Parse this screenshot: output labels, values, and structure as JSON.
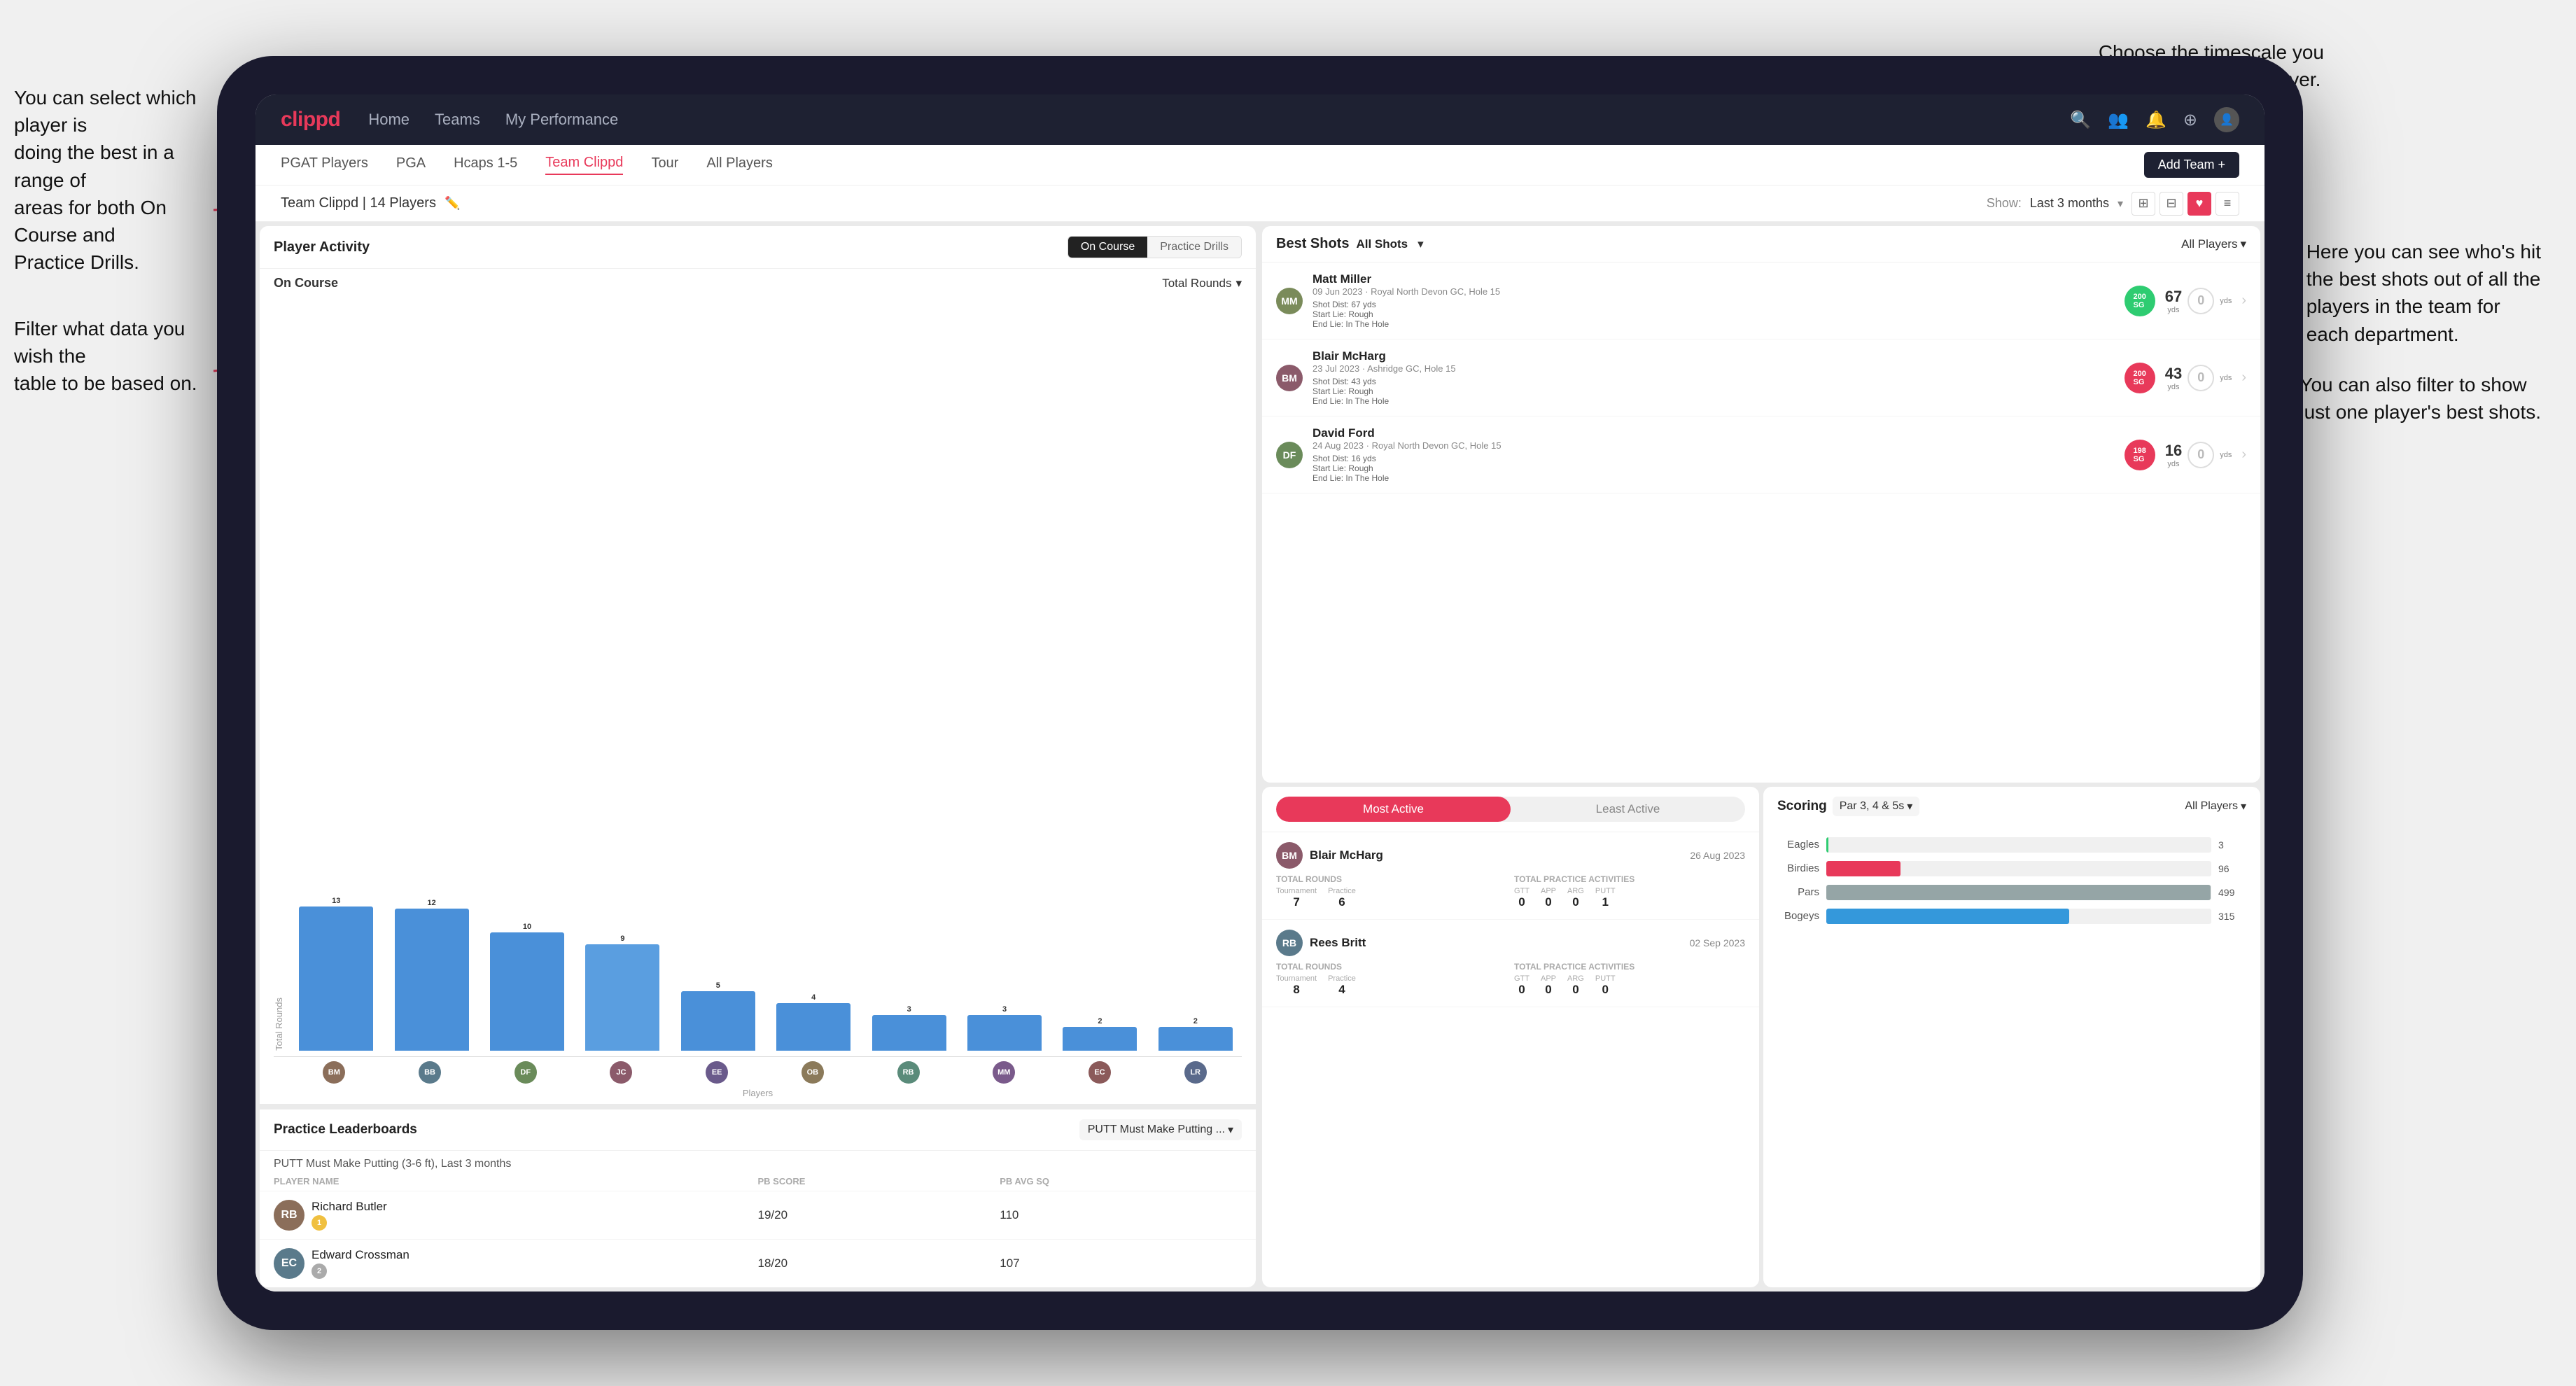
{
  "annotations": {
    "top_right": "Choose the timescale you\nwish to see the data over.",
    "left_1": "You can select which player is\ndoing the best in a range of\nareas for both On Course and\nPractice Drills.",
    "left_2": "Filter what data you wish the\ntable to be based on.",
    "right_1": "Here you can see who's hit\nthe best shots out of all the\nplayers in the team for\neach department.",
    "right_2": "You can also filter to show\njust one player's best shots."
  },
  "nav": {
    "logo": "clippd",
    "items": [
      "Home",
      "Teams",
      "My Performance"
    ],
    "icons": [
      "🔍",
      "👥",
      "🔔",
      "⊕",
      "👤"
    ],
    "add_team_label": "Add Team +"
  },
  "tabs": {
    "items": [
      "PGAT Players",
      "PGA",
      "Hcaps 1-5",
      "Team Clippd",
      "Tour",
      "All Players"
    ],
    "active": "Team Clippd"
  },
  "sub_header": {
    "title": "Team Clippd | 14 Players",
    "show_label": "Show:",
    "show_value": "Last 3 months",
    "view_icons": [
      "grid",
      "grid2",
      "heart",
      "list"
    ]
  },
  "player_activity": {
    "title": "Player Activity",
    "toggle": [
      "On Course",
      "Practice Drills"
    ],
    "active_toggle": "On Course",
    "sub_title": "On Course",
    "filter": "Total Rounds",
    "y_label": "Total Rounds",
    "x_label": "Players",
    "bars": [
      {
        "label": "B. McHarg",
        "value": 13,
        "height": 100
      },
      {
        "label": "B. Britt",
        "value": 12,
        "height": 92
      },
      {
        "label": "D. Ford",
        "value": 10,
        "height": 77
      },
      {
        "label": "J. Coles",
        "value": 9,
        "height": 69
      },
      {
        "label": "E. Ebert",
        "value": 5,
        "height": 38
      },
      {
        "label": "O. Billingham",
        "value": 4,
        "height": 31
      },
      {
        "label": "R. Butler",
        "value": 3,
        "height": 23
      },
      {
        "label": "M. Miller",
        "value": 3,
        "height": 23
      },
      {
        "label": "E. Crossman",
        "value": 2,
        "height": 15
      },
      {
        "label": "L. Robertson",
        "value": 2,
        "height": 15
      }
    ],
    "y_ticks": [
      0,
      5,
      10,
      15
    ]
  },
  "best_shots": {
    "title": "Best Shots",
    "tabs": [
      "All Shots",
      "All Players"
    ],
    "shots": [
      {
        "player": "Matt Miller",
        "date": "09 Jun 2023",
        "course": "Royal North Devon GC",
        "hole": "Hole 15",
        "badge_text": "200\nSG",
        "badge_color": "green",
        "dist": "Shot Dist: 67 yds\nStart Lie: Rough\nEnd Lie: In The Hole",
        "stat1_val": "67",
        "stat1_unit": "yds",
        "stat2_val": "0",
        "stat2_unit": "yds"
      },
      {
        "player": "Blair McHarg",
        "date": "23 Jul 2023",
        "course": "Ashridge GC",
        "hole": "Hole 15",
        "badge_text": "200\nSG",
        "badge_color": "pink",
        "dist": "Shot Dist: 43 yds\nStart Lie: Rough\nEnd Lie: In The Hole",
        "stat1_val": "43",
        "stat1_unit": "yds",
        "stat2_val": "0",
        "stat2_unit": "yds"
      },
      {
        "player": "David Ford",
        "date": "24 Aug 2023",
        "course": "Royal North Devon GC",
        "hole": "Hole 15",
        "badge_text": "198\nSG",
        "badge_color": "pink",
        "dist": "Shot Dist: 16 yds\nStart Lie: Rough\nEnd Lie: In The Hole",
        "stat1_val": "16",
        "stat1_unit": "yds",
        "stat2_val": "0",
        "stat2_unit": "yds"
      }
    ]
  },
  "practice_leaderboards": {
    "title": "Practice Leaderboards",
    "dropdown": "PUTT Must Make Putting ...",
    "subtitle": "PUTT Must Make Putting (3-6 ft), Last 3 months",
    "columns": [
      "PLAYER NAME",
      "PB SCORE",
      "PB AVG SQ"
    ],
    "rows": [
      {
        "name": "Richard Butler",
        "pb_score": "19/20",
        "pb_avg": "110",
        "rank": 1,
        "rank_color": "gold"
      },
      {
        "name": "Edward Crossman",
        "pb_score": "18/20",
        "pb_avg": "107",
        "rank": 2,
        "rank_color": "silver"
      }
    ]
  },
  "most_active": {
    "tabs": [
      "Most Active",
      "Least Active"
    ],
    "active_tab": "Most Active",
    "players": [
      {
        "name": "Blair McHarg",
        "date": "26 Aug 2023",
        "total_rounds_label": "Total Rounds",
        "tournament": "7",
        "practice": "6",
        "total_practice_label": "Total Practice Activities",
        "gtt": "0",
        "app": "0",
        "arg": "0",
        "putt": "1"
      },
      {
        "name": "Rees Britt",
        "date": "02 Sep 2023",
        "total_rounds_label": "Total Rounds",
        "tournament": "8",
        "practice": "4",
        "total_practice_label": "Total Practice Activities",
        "gtt": "0",
        "app": "0",
        "arg": "0",
        "putt": "0"
      }
    ]
  },
  "scoring": {
    "title": "Scoring",
    "filter1": "Par 3, 4 & 5s",
    "filter2": "All Players",
    "bars": [
      {
        "label": "Eagles",
        "value": 3,
        "max": 500,
        "color": "#2ecc71"
      },
      {
        "label": "Birdies",
        "value": 96,
        "max": 500,
        "color": "#e74c3c"
      },
      {
        "label": "Pars",
        "value": 499,
        "max": 500,
        "color": "#95a5a6"
      },
      {
        "label": "Bogeys",
        "value": 315,
        "max": 500,
        "color": "#3498db"
      }
    ]
  },
  "colors": {
    "brand": "#e8395a",
    "nav_bg": "#1e2132",
    "accent_green": "#2ecc71",
    "accent_blue": "#4a90d9"
  }
}
